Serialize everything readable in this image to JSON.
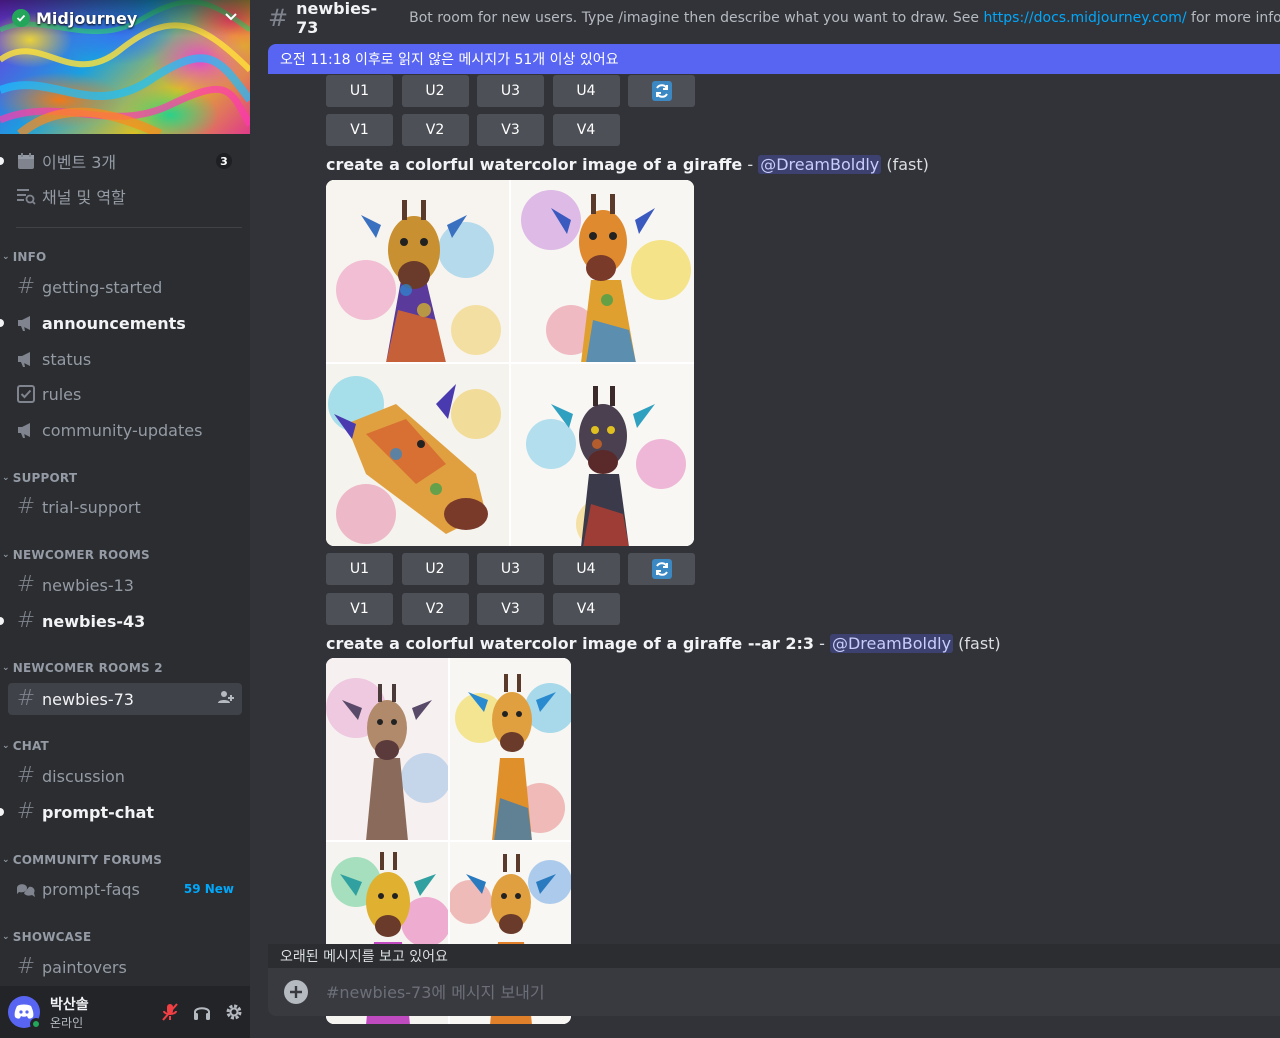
{
  "server": {
    "name": "Midjourney"
  },
  "sidebar": {
    "events": {
      "label": "이벤트 3개",
      "count": "3"
    },
    "channels_roles": {
      "label": "채널 및 역할"
    },
    "categories": {
      "info": "INFO",
      "support": "SUPPORT",
      "newcomer_rooms": "NEWCOMER ROOMS",
      "newcomer_rooms_2": "NEWCOMER ROOMS 2",
      "chat": "CHAT",
      "community_forums": "COMMUNITY FORUMS",
      "showcase": "SHOWCASE"
    },
    "channels": {
      "getting_started": "getting-started",
      "announcements": "announcements",
      "status": "status",
      "rules": "rules",
      "community_updates": "community-updates",
      "trial_support": "trial-support",
      "newbies_13": "newbies-13",
      "newbies_43": "newbies-43",
      "newbies_73": "newbies-73",
      "discussion": "discussion",
      "prompt_chat": "prompt-chat",
      "prompt_faqs": "prompt-faqs",
      "prompt_faqs_new": "59 New",
      "paintovers": "paintovers"
    }
  },
  "user": {
    "name": "박산솔",
    "status": "온라인"
  },
  "header": {
    "channel": "newbies-73",
    "topic_prefix": "Bot room for new users. Type /imagine then describe what you want to draw. See ",
    "topic_link": "https://docs.midjourney.com/",
    "topic_suffix": " for more information"
  },
  "unread_banner": "오전 11:18 이후로 읽지 않은 메시지가 51개 이상 있어요",
  "buttons": {
    "u1": "U1",
    "u2": "U2",
    "u3": "U3",
    "u4": "U4",
    "v1": "V1",
    "v2": "V2",
    "v3": "V3",
    "v4": "V4"
  },
  "messages": [
    {
      "prompt": "create a colorful watercolor image of a giraffe",
      "dash": " - ",
      "mention": "@DreamBoldly",
      "speed": " (fast)"
    },
    {
      "prompt": "create a colorful watercolor image of a giraffe --ar 2:3",
      "dash": " - ",
      "mention": "@DreamBoldly",
      "speed": " (fast)"
    }
  ],
  "old_messages_notice": "오래된 메시지를 보고 있어요",
  "composer": {
    "placeholder": "#newbies-73에 메시지 보내기"
  },
  "colors": {
    "accent": "#5865f2",
    "online": "#23a55a",
    "link": "#00a8fc"
  }
}
